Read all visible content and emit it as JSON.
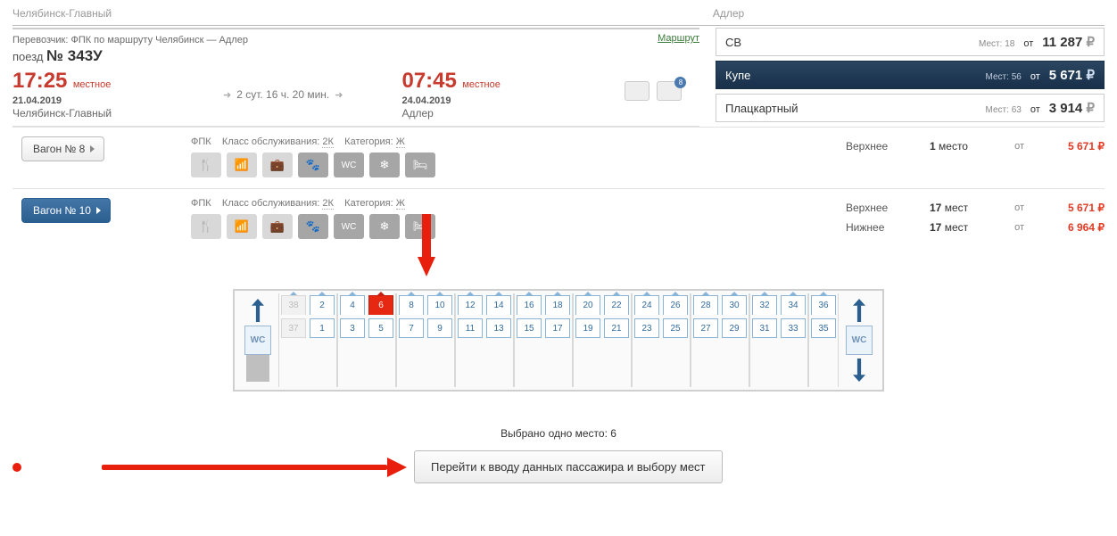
{
  "top_leftover_from": "Челябинск-Главный",
  "top_leftover_to": "Адлер",
  "carrier_line": "Перевозчик: ФПК   по маршруту Челябинск — Адлер",
  "route_link": "Маршрут",
  "train_label": "поезд",
  "train_no": "№ 343У",
  "departure": {
    "time": "17:25",
    "time_label": "местное",
    "date": "21.04.2019",
    "city": "Челябинск-Главный"
  },
  "arrival": {
    "time": "07:45",
    "time_label": "местное",
    "date": "24.04.2019",
    "city": "Адлер"
  },
  "duration": "2 сут. 16 ч. 20 мин.",
  "luggage_badge": "8",
  "fares": [
    {
      "name": "СВ",
      "seats_label": "Мест:",
      "seats": 18,
      "from": "от",
      "price": "11 287",
      "dark": false
    },
    {
      "name": "Купе",
      "seats_label": "Мест:",
      "seats": 56,
      "from": "от",
      "price": "5 671",
      "dark": true
    },
    {
      "name": "Плацкартный",
      "seats_label": "Мест:",
      "seats": 63,
      "from": "от",
      "price": "3 914",
      "dark": false
    }
  ],
  "wagon8": {
    "btn": "Вагон  № 8",
    "carrier": "ФПК",
    "svc_label": "Класс обслуживания:",
    "svc": "2К",
    "cat_label": "Категория:",
    "cat": "Ж",
    "rows": [
      {
        "label": "Верхнее",
        "count": "1 место",
        "from": "от",
        "price": "5 671 ₽"
      }
    ]
  },
  "wagon10": {
    "btn": "Вагон  № 10",
    "carrier": "ФПК",
    "svc_label": "Класс обслуживания:",
    "svc": "2К",
    "cat_label": "Категория:",
    "cat": "Ж",
    "rows": [
      {
        "label": "Верхнее",
        "count": "17 мест",
        "from": "от",
        "price": "5 671 ₽"
      },
      {
        "label": "Нижнее",
        "count": "17 мест",
        "from": "от",
        "price": "6 964 ₽"
      }
    ]
  },
  "wc": "WC",
  "comps": [
    {
      "upper": [
        38,
        2
      ],
      "lower": [
        37,
        1
      ],
      "side": []
    },
    {
      "upper": [
        4,
        6
      ],
      "lower": [
        3,
        5
      ],
      "side": []
    },
    {
      "upper": [
        8,
        10
      ],
      "lower": [
        7,
        9
      ],
      "side": []
    },
    {
      "upper": [
        12,
        14
      ],
      "lower": [
        11,
        13
      ],
      "side": []
    },
    {
      "upper": [
        16,
        18
      ],
      "lower": [
        15,
        17
      ],
      "side": []
    },
    {
      "upper": [
        20,
        22
      ],
      "lower": [
        19,
        21
      ],
      "side": []
    },
    {
      "upper": [
        24,
        26
      ],
      "lower": [
        23,
        25
      ],
      "side": []
    },
    {
      "upper": [
        28,
        30
      ],
      "lower": [
        27,
        29
      ],
      "side": []
    },
    {
      "upper": [
        32,
        34
      ],
      "lower": [
        31,
        33
      ],
      "side": []
    },
    {
      "upper": [
        36
      ],
      "lower": [
        35
      ],
      "side": []
    }
  ],
  "selected_seat": 6,
  "taken_seats": [
    38,
    37
  ],
  "selection_text": "Выбрано одно место: 6",
  "proceed": "Перейти к вводу данных пассажира и выбору мест",
  "rub": "₽"
}
